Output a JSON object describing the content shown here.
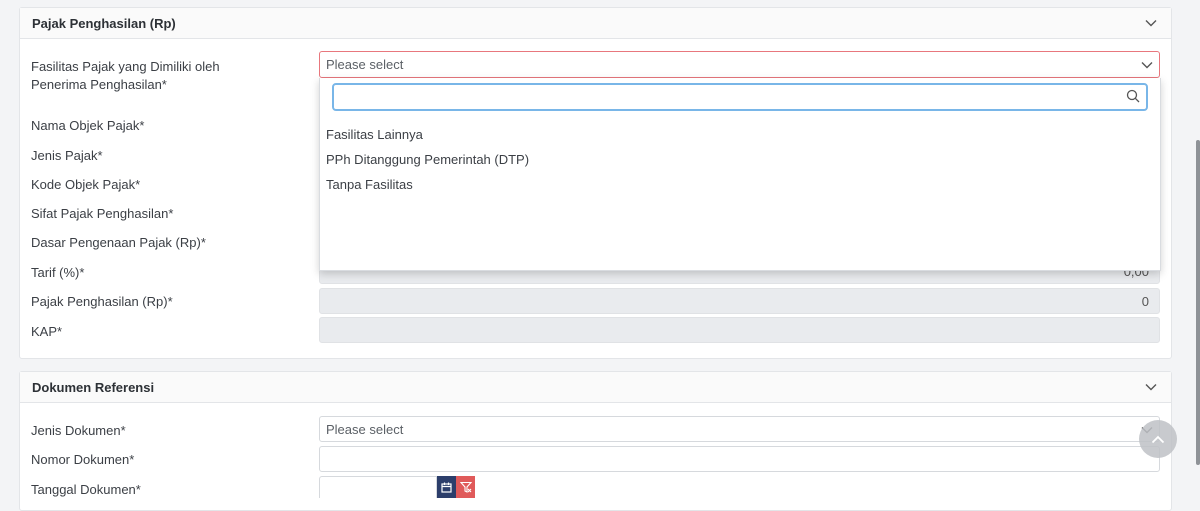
{
  "tax_section": {
    "title": "Pajak Penghasilan (Rp)",
    "facility_label": "Fasilitas Pajak yang Dimiliki oleh Penerima Penghasilan*",
    "facility_placeholder": "Please select",
    "object_name_label": "Nama Objek Pajak*",
    "tax_type_label": "Jenis Pajak*",
    "object_code_label": "Kode Objek Pajak*",
    "nature_label": "Sifat Pajak Penghasilan*",
    "base_label": "Dasar Pengenaan Pajak (Rp)*",
    "rate_label": "Tarif (%)*",
    "rate_value": "0,00",
    "income_tax_label": "Pajak Penghasilan (Rp)*",
    "income_tax_value": "0",
    "kap_label": "KAP*",
    "kap_value": ""
  },
  "dropdown": {
    "search_value": "",
    "options": [
      "Fasilitas Lainnya",
      "PPh Ditanggung Pemerintah (DTP)",
      "Tanpa Fasilitas"
    ]
  },
  "reference_section": {
    "title": "Dokumen Referensi",
    "doc_type_label": "Jenis Dokumen*",
    "doc_type_placeholder": "Please select",
    "doc_number_label": "Nomor Dokumen*",
    "doc_number_value": "",
    "doc_date_label": "Tanggal Dokumen*"
  },
  "colors": {
    "accent_blue": "#79b6e8",
    "error_border": "#e8777d",
    "calendar_button": "#2c3e6b",
    "clear_button": "#e05a5a"
  },
  "icons": [
    "chevron-down-icon",
    "search-icon",
    "calendar-icon",
    "filter-clear-icon",
    "chevron-up-icon"
  ]
}
